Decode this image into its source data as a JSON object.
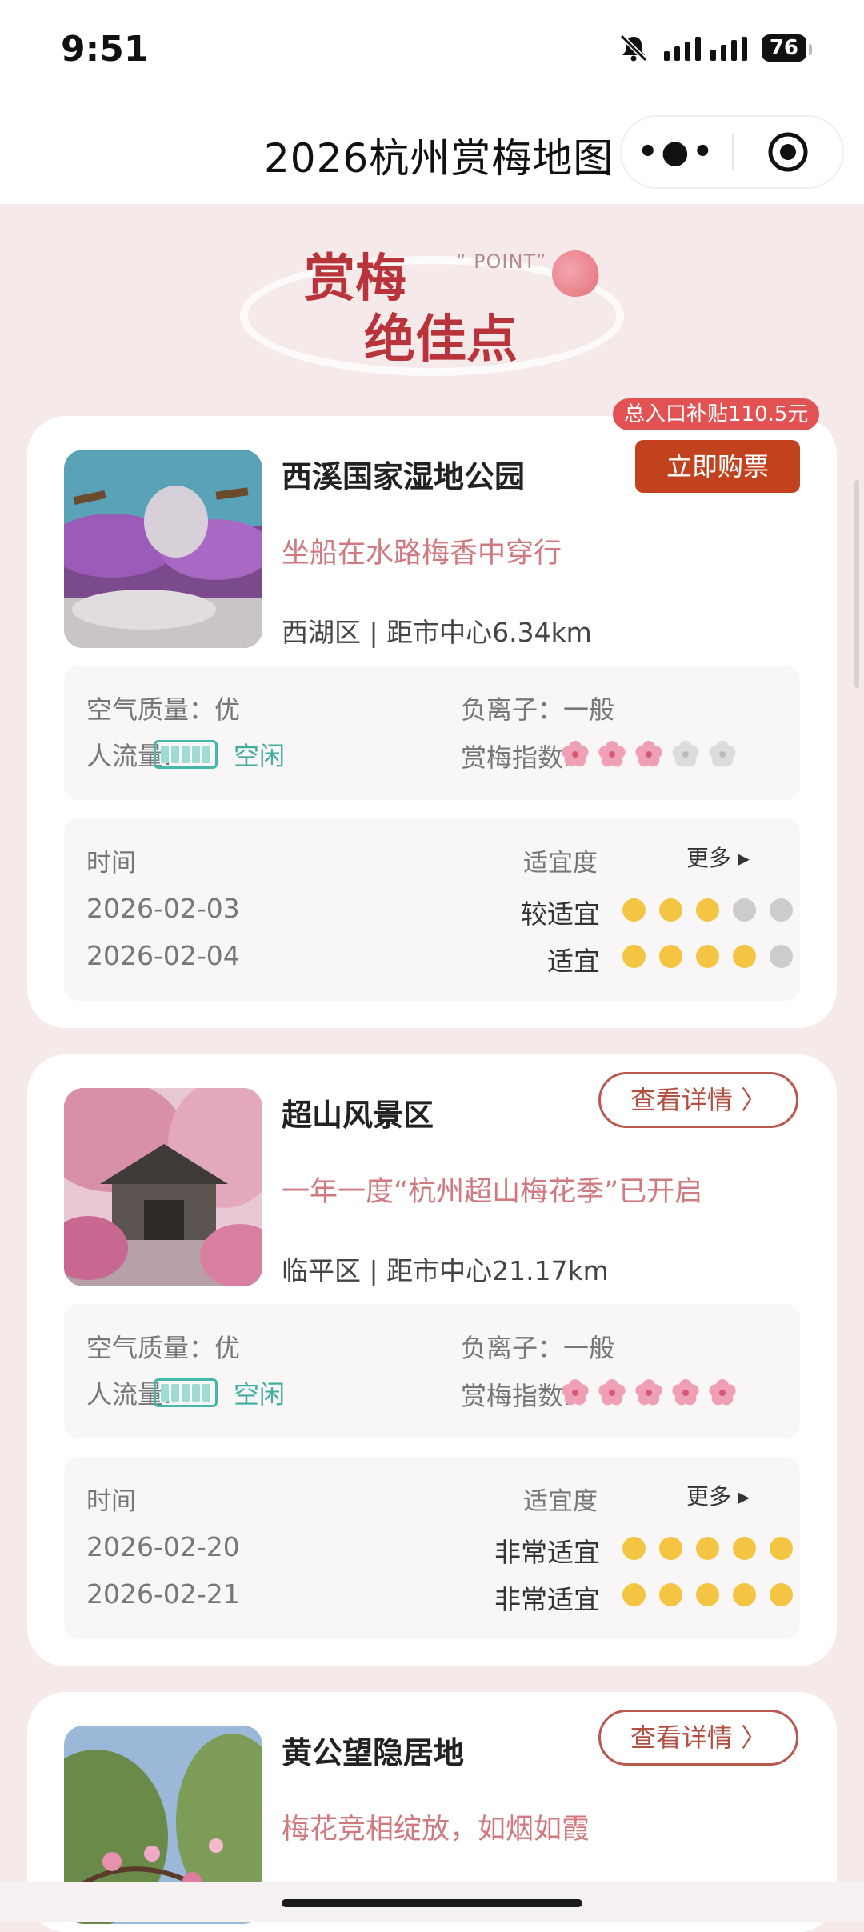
{
  "status": {
    "time": "9:51",
    "battery": "76"
  },
  "nav": {
    "title": "2026杭州赏梅地图"
  },
  "banner": {
    "line1": "赏梅",
    "line2": "绝佳点",
    "point": "“ POINT”"
  },
  "labels": {
    "air": "空气质量：优",
    "ion": "负离子：一般",
    "crowd": "人流量:",
    "crowd_status": "空闲",
    "index": "赏梅指数:",
    "time": "时间",
    "suit": "适宜度",
    "more": "更多 ▸"
  },
  "spots": [
    {
      "name": "西溪国家湿地公园",
      "desc": "坐船在水路梅香中穿行",
      "loc": "西湖区 | 距市中心6.34km",
      "subsidy": "总入口补贴110.5元",
      "action": "立即购票",
      "flower_rating": 3,
      "rows": [
        {
          "date": "2026-02-03",
          "level": "较适宜",
          "dots": 3
        },
        {
          "date": "2026-02-04",
          "level": "适宜",
          "dots": 4
        }
      ]
    },
    {
      "name": "超山风景区",
      "desc": "一年一度“杭州超山梅花季”已开启",
      "loc": "临平区 | 距市中心21.17km",
      "action": "查看详情 〉",
      "flower_rating": 5,
      "rows": [
        {
          "date": "2026-02-20",
          "level": "非常适宜",
          "dots": 5
        },
        {
          "date": "2026-02-21",
          "level": "非常适宜",
          "dots": 5
        }
      ]
    },
    {
      "name": "黄公望隐居地",
      "desc": "梅花竞相绽放，如烟如霞",
      "action": "查看详情 〉"
    }
  ],
  "colors": {
    "accent": "#c2421e",
    "gold": "#f4c542",
    "pink": "#d0797e",
    "teal": "#3fae9f"
  }
}
